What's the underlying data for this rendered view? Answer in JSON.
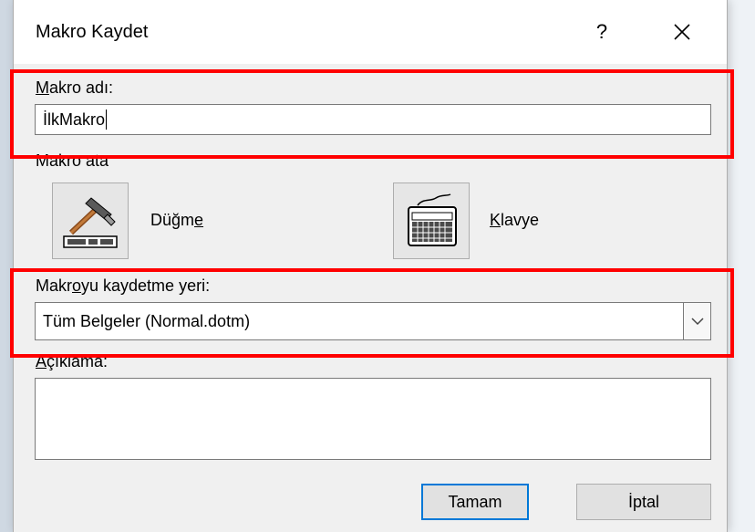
{
  "dialog": {
    "title": "Makro Kaydet",
    "help_label": "?",
    "close_icon": "close-icon"
  },
  "macro_name": {
    "label_prefix": "M",
    "label_rest": "akro adı:",
    "value": "İlkMakro"
  },
  "assign": {
    "label": "Makro ata",
    "button_label_prefix": "Düğm",
    "button_label_mnemonic": "e",
    "button_icon": "hammer-icon",
    "keyboard_label_mnemonic": "K",
    "keyboard_label_rest": "lavye",
    "keyboard_icon": "keyboard-icon"
  },
  "store_in": {
    "label_prefix": "Makr",
    "label_mnemonic": "o",
    "label_rest": "yu kaydetme yeri:",
    "selected": "Tüm Belgeler (Normal.dotm)",
    "arrow_icon": "chevron-down-icon"
  },
  "description": {
    "label_mnemonic": "A",
    "label_rest": "çıklama:",
    "value": ""
  },
  "buttons": {
    "ok": "Tamam",
    "cancel": "İptal"
  },
  "colors": {
    "highlight": "#ff0000",
    "dialog_bg": "#f0f0f0",
    "default_button_border": "#0078d7"
  }
}
